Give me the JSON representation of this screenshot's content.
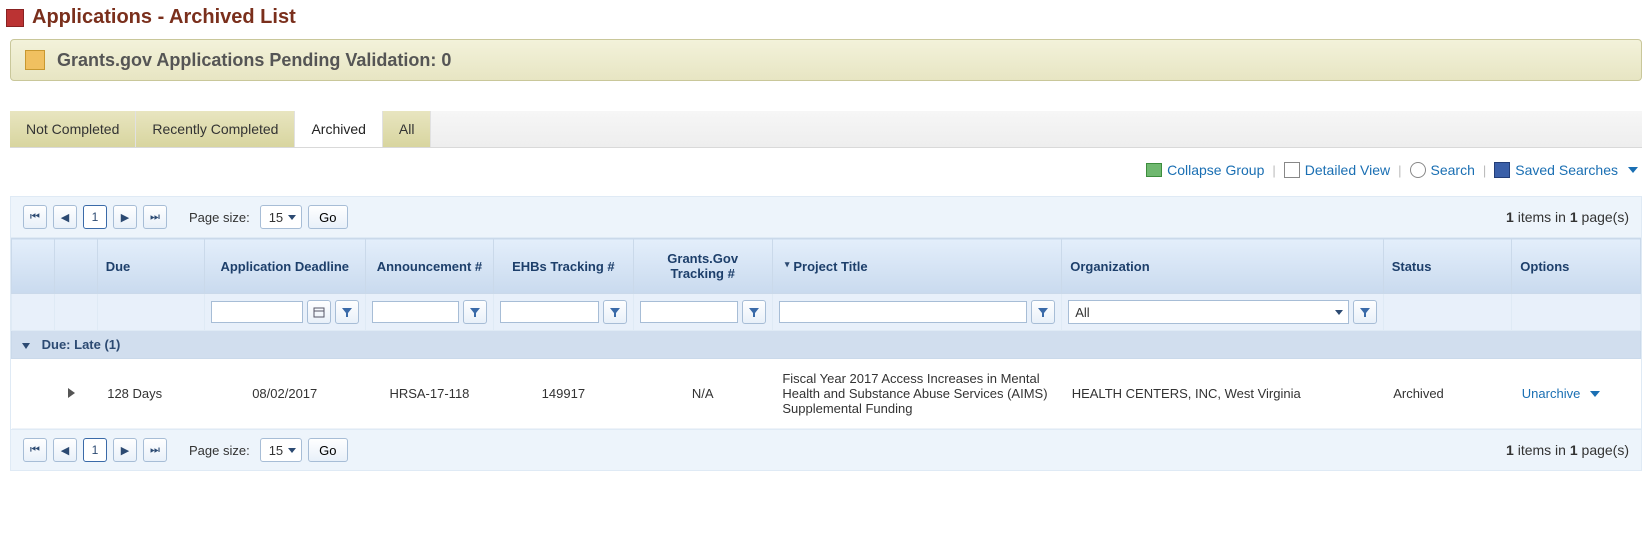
{
  "title": "Applications - Archived List",
  "banner": {
    "label_prefix": "Grants.gov Applications Pending Validation:",
    "count": "0"
  },
  "tabs": [
    {
      "id": "not-completed",
      "label": "Not Completed",
      "active": false
    },
    {
      "id": "recently-completed",
      "label": "Recently Completed",
      "active": false
    },
    {
      "id": "archived",
      "label": "Archived",
      "active": true
    },
    {
      "id": "all",
      "label": "All",
      "active": false
    }
  ],
  "toolbar": {
    "collapse_group": "Collapse Group",
    "detailed_view": "Detailed View",
    "search": "Search",
    "saved_searches": "Saved Searches"
  },
  "pager": {
    "page_size_label": "Page size:",
    "page_size": "15",
    "go": "Go",
    "current_page": "1",
    "summary_prefix": " items in ",
    "summary_suffix": " page(s)",
    "total_items": "1",
    "total_pages": "1"
  },
  "columns": {
    "due": "Due",
    "deadline": "Application Deadline",
    "announcement": "Announcement #",
    "ehb": "EHBs Tracking #",
    "grants_gov": "Grants.Gov Tracking #",
    "project_title": "Project Title",
    "organization": "Organization",
    "status": "Status",
    "options": "Options"
  },
  "filters": {
    "org_select": "All"
  },
  "group": {
    "label": "Due: Late (1)"
  },
  "row": {
    "due": "128 Days",
    "deadline": "08/02/2017",
    "announcement": "HRSA-17-118",
    "ehb": "149917",
    "grants_gov": "N/A",
    "project_title": "Fiscal Year 2017 Access Increases in Mental Health and Substance Abuse Services (AIMS) Supplemental Funding",
    "organization": "HEALTH CENTERS, INC, West Virginia",
    "status": "Archived",
    "option_action": "Unarchive"
  }
}
